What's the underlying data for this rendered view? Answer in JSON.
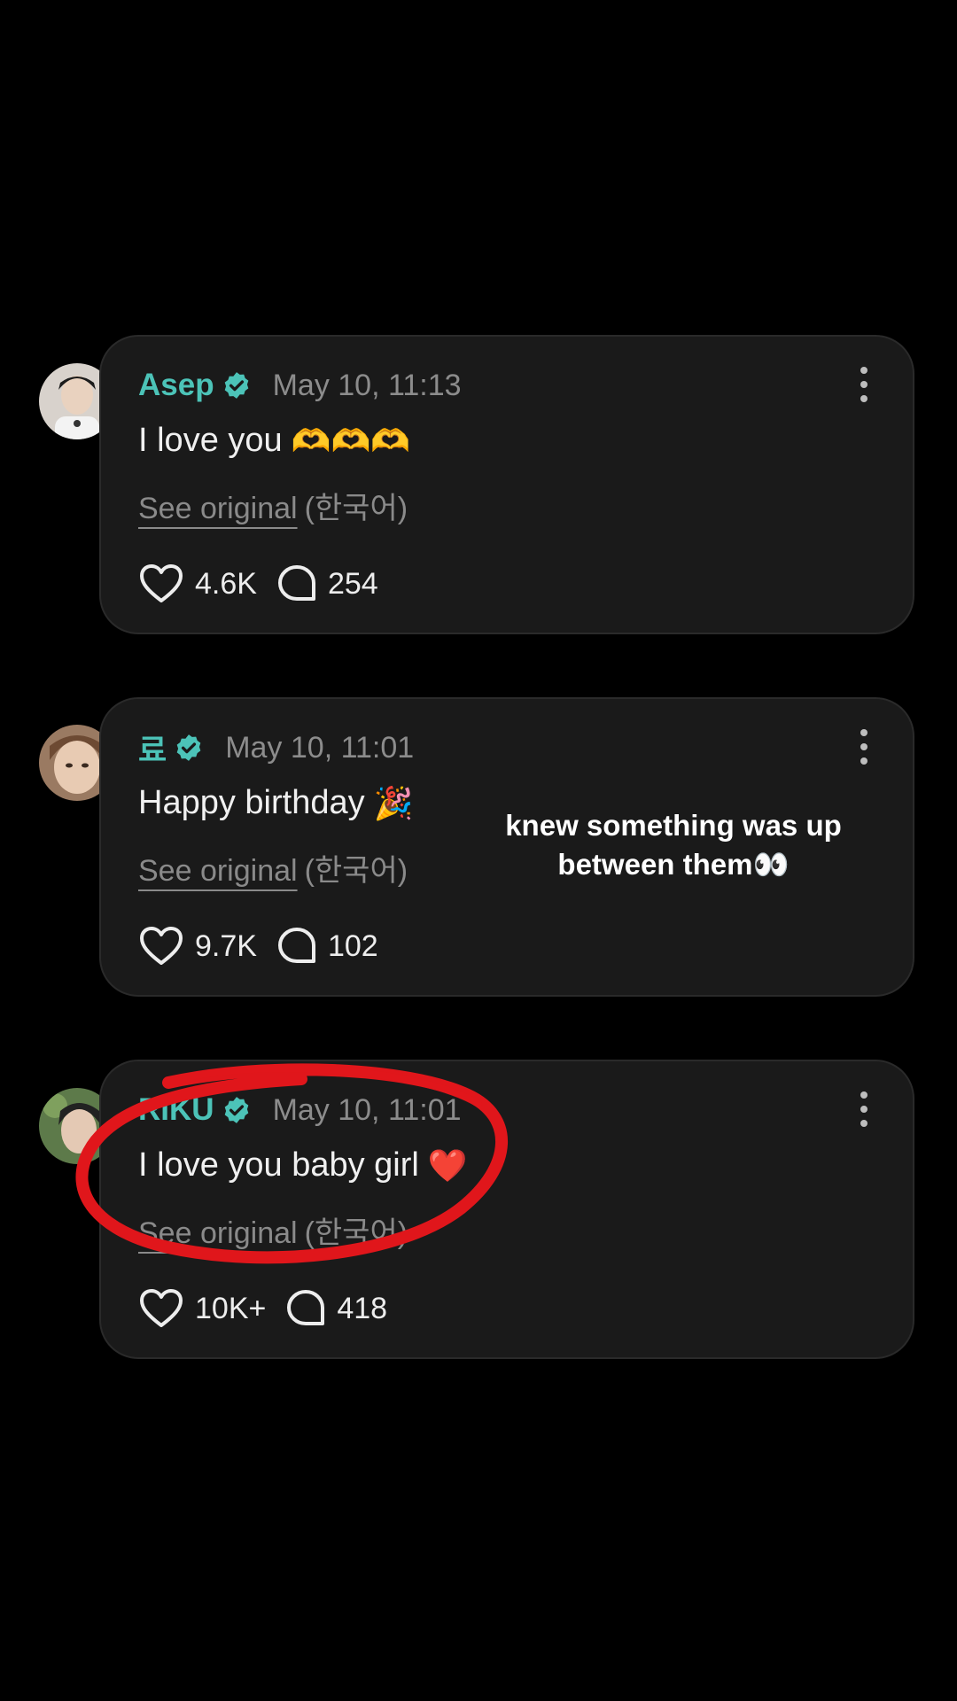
{
  "posts": [
    {
      "author": "Asep",
      "date": "May 10, 11:13",
      "text": "I love you",
      "emoji": "🫶🫶🫶",
      "see_original": "See original",
      "language": "(한국어)",
      "likes": "4.6K",
      "comments": "254"
    },
    {
      "author": "료",
      "date": "May 10, 11:01",
      "text": "Happy birthday",
      "emoji": "🎉",
      "see_original": "See original",
      "language": "(한국어)",
      "likes": "9.7K",
      "comments": "102"
    },
    {
      "author": "RIKU",
      "date": "May 10, 11:01",
      "text": "I love you baby girl",
      "emoji": "❤️",
      "see_original": "See original",
      "language": "(한국어)",
      "likes": "10K+",
      "comments": "418"
    }
  ],
  "overlay": {
    "caption_line1": "knew something was up",
    "caption_line2": "between them👀"
  },
  "colors": {
    "background": "#000000",
    "card": "#1a1a1a",
    "author": "#4cc3b8",
    "verified": "#4cc3b8",
    "annotation": "#e0161b"
  },
  "icons": {
    "verified": "verified-badge-icon",
    "like": "heart-icon",
    "comment": "comment-bubble-icon",
    "more": "more-vertical-icon"
  }
}
